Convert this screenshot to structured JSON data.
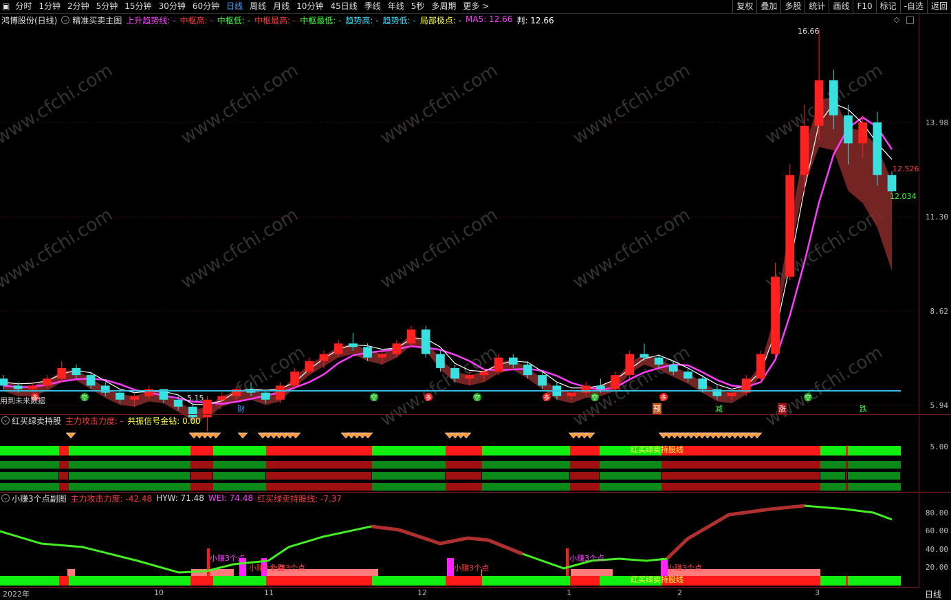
{
  "toolbar": {
    "left_items": [
      "分时",
      "1分钟",
      "2分钟",
      "5分钟",
      "15分钟",
      "30分钟",
      "60分钟",
      "日线",
      "周线",
      "月线",
      "10分钟",
      "45日线",
      "季线",
      "年线",
      "5秒",
      "多周期",
      "更多 >"
    ],
    "active": "日线",
    "right_items": [
      "复权",
      "叠加",
      "多股",
      "统计",
      "画线",
      "F10",
      "标记",
      "-自选",
      "返回"
    ]
  },
  "main_legend": {
    "stock": "鸿博股份(日线)",
    "indicator": "精准买卖主图",
    "items": [
      {
        "text": "上升趋势线: -",
        "color": "#ff3cff"
      },
      {
        "text": "中枢高: -",
        "color": "#ff3b3b"
      },
      {
        "text": "中枢低: -",
        "color": "#3cff3c"
      },
      {
        "text": "中枢最高: -",
        "color": "#ff3b3b"
      },
      {
        "text": "中枢最低: -",
        "color": "#3cff3c"
      },
      {
        "text": "趋势高: -",
        "color": "#38e0ff"
      },
      {
        "text": "趋势低: -",
        "color": "#38e0ff"
      },
      {
        "text": "局部极点: -",
        "color": "#ffff3c"
      },
      {
        "text": "MA5: 12.66",
        "color": "#ff3cff"
      },
      {
        "text": "判: 12.66",
        "color": "#ffffff"
      }
    ]
  },
  "main_axis": [
    "13.98",
    "11.30",
    "8.62",
    "5.94"
  ],
  "main_annotations": {
    "high": "16.66",
    "last_high": "12.526",
    "last_low": "12.034",
    "low_mark": "5.15",
    "footer_note": "用到未来数据"
  },
  "main_markers": {
    "cai": "财",
    "yu": "预",
    "jian": "减",
    "zhang": "涨",
    "die": "跌",
    "duo": "多",
    "kong": "空",
    "mai": "买",
    "mai2": "卖"
  },
  "sub1": {
    "title": "红买绿卖持股",
    "items": [
      {
        "text": "主力攻击力度: -",
        "color": "#ff3b3b"
      },
      {
        "text": "共振信号金钻: 0.00",
        "color": "#ffff3c"
      }
    ],
    "axis": "5.00",
    "label": "红买绿卖持股线"
  },
  "sub2": {
    "title": "小赚3个点副图",
    "items": [
      {
        "text": "主力攻击力度: -42.48",
        "color": "#ff3b3b"
      },
      {
        "text": "HYW: 71.48",
        "color": "#dddddd"
      },
      {
        "text": "WEI: 74.48",
        "color": "#ff3cff"
      },
      {
        "text": "红买绿卖持股线: -7.37",
        "color": "#ff3b3b"
      }
    ],
    "axis": [
      "80.00",
      "60.00",
      "40.00",
      "20.00"
    ],
    "tag": "小赚3个点",
    "label": "红买绿卖持股线"
  },
  "xaxis": [
    "2022年",
    "10",
    "11",
    "12",
    "1",
    "2",
    "3"
  ],
  "period_label": "日线",
  "watermark": "www.cfchi.com",
  "colors": {
    "up": "#ff2020",
    "down": "#38e0e0",
    "band": "#a03030",
    "ma": "#ff3cff",
    "green": "#11ee11",
    "red": "#ff1a1a"
  },
  "chart_data": {
    "type": "candlestick",
    "title": "鸿博股份(日线)",
    "ylim": [
      5.94,
      16.66
    ],
    "yticks": [
      13.98,
      11.3,
      8.62,
      5.94
    ],
    "x": [
      "2022年",
      "10",
      "11",
      "12",
      "1",
      "2",
      "3"
    ],
    "ohlc": [
      [
        6.7,
        6.8,
        6.4,
        6.5
      ],
      [
        6.5,
        6.6,
        6.3,
        6.4
      ],
      [
        6.4,
        6.6,
        6.3,
        6.5
      ],
      [
        6.5,
        6.8,
        6.4,
        6.7
      ],
      [
        6.7,
        7.2,
        6.6,
        7.0
      ],
      [
        7.0,
        7.1,
        6.7,
        6.8
      ],
      [
        6.8,
        6.9,
        6.4,
        6.5
      ],
      [
        6.5,
        6.6,
        6.2,
        6.3
      ],
      [
        6.3,
        6.4,
        6.0,
        6.1
      ],
      [
        6.1,
        6.3,
        5.9,
        6.2
      ],
      [
        6.2,
        6.5,
        6.1,
        6.4
      ],
      [
        6.4,
        6.4,
        6.0,
        6.1
      ],
      [
        6.1,
        6.2,
        5.8,
        5.9
      ],
      [
        5.9,
        6.0,
        5.5,
        5.6
      ],
      [
        5.6,
        6.2,
        5.2,
        6.1
      ],
      [
        6.1,
        6.3,
        6.0,
        6.2
      ],
      [
        6.2,
        6.5,
        6.1,
        6.4
      ],
      [
        6.4,
        6.6,
        6.2,
        6.3
      ],
      [
        6.3,
        6.4,
        6.0,
        6.1
      ],
      [
        6.1,
        6.6,
        6.0,
        6.5
      ],
      [
        6.5,
        7.0,
        6.4,
        6.9
      ],
      [
        6.9,
        7.3,
        6.8,
        7.2
      ],
      [
        7.2,
        7.5,
        7.0,
        7.4
      ],
      [
        7.4,
        7.8,
        7.3,
        7.7
      ],
      [
        7.7,
        8.0,
        7.5,
        7.6
      ],
      [
        7.6,
        7.7,
        7.2,
        7.3
      ],
      [
        7.3,
        7.5,
        7.1,
        7.4
      ],
      [
        7.4,
        7.8,
        7.3,
        7.7
      ],
      [
        7.7,
        8.2,
        7.6,
        8.1
      ],
      [
        8.1,
        8.2,
        7.3,
        7.4
      ],
      [
        7.4,
        7.5,
        6.9,
        7.0
      ],
      [
        7.0,
        7.1,
        6.6,
        6.7
      ],
      [
        6.7,
        6.9,
        6.5,
        6.8
      ],
      [
        6.8,
        7.0,
        6.6,
        6.9
      ],
      [
        6.9,
        7.4,
        6.8,
        7.3
      ],
      [
        7.3,
        7.4,
        7.0,
        7.1
      ],
      [
        7.1,
        7.2,
        6.7,
        6.8
      ],
      [
        6.8,
        6.9,
        6.4,
        6.5
      ],
      [
        6.5,
        6.6,
        6.1,
        6.2
      ],
      [
        6.2,
        6.4,
        6.1,
        6.3
      ],
      [
        6.3,
        6.6,
        6.2,
        6.5
      ],
      [
        6.5,
        6.7,
        6.3,
        6.4
      ],
      [
        6.4,
        6.9,
        6.3,
        6.8
      ],
      [
        6.8,
        7.5,
        6.7,
        7.4
      ],
      [
        7.4,
        7.7,
        7.2,
        7.3
      ],
      [
        7.3,
        7.4,
        7.0,
        7.1
      ],
      [
        7.1,
        7.2,
        6.8,
        6.9
      ],
      [
        6.9,
        7.0,
        6.6,
        6.7
      ],
      [
        6.7,
        6.8,
        6.3,
        6.4
      ],
      [
        6.4,
        6.5,
        6.1,
        6.2
      ],
      [
        6.2,
        6.4,
        6.1,
        6.3
      ],
      [
        6.3,
        6.8,
        6.2,
        6.7
      ],
      [
        6.7,
        7.5,
        6.6,
        7.4
      ],
      [
        7.4,
        10.0,
        7.3,
        9.6
      ],
      [
        9.6,
        12.8,
        9.5,
        12.5
      ],
      [
        12.5,
        14.5,
        12.0,
        13.9
      ],
      [
        13.9,
        16.66,
        13.5,
        15.2
      ],
      [
        15.2,
        15.5,
        13.8,
        14.2
      ],
      [
        14.2,
        14.5,
        12.8,
        13.4
      ],
      [
        13.4,
        14.2,
        13.0,
        14.0
      ],
      [
        14.0,
        14.3,
        12.2,
        12.5
      ],
      [
        12.5,
        12.6,
        12.0,
        12.034
      ]
    ]
  }
}
